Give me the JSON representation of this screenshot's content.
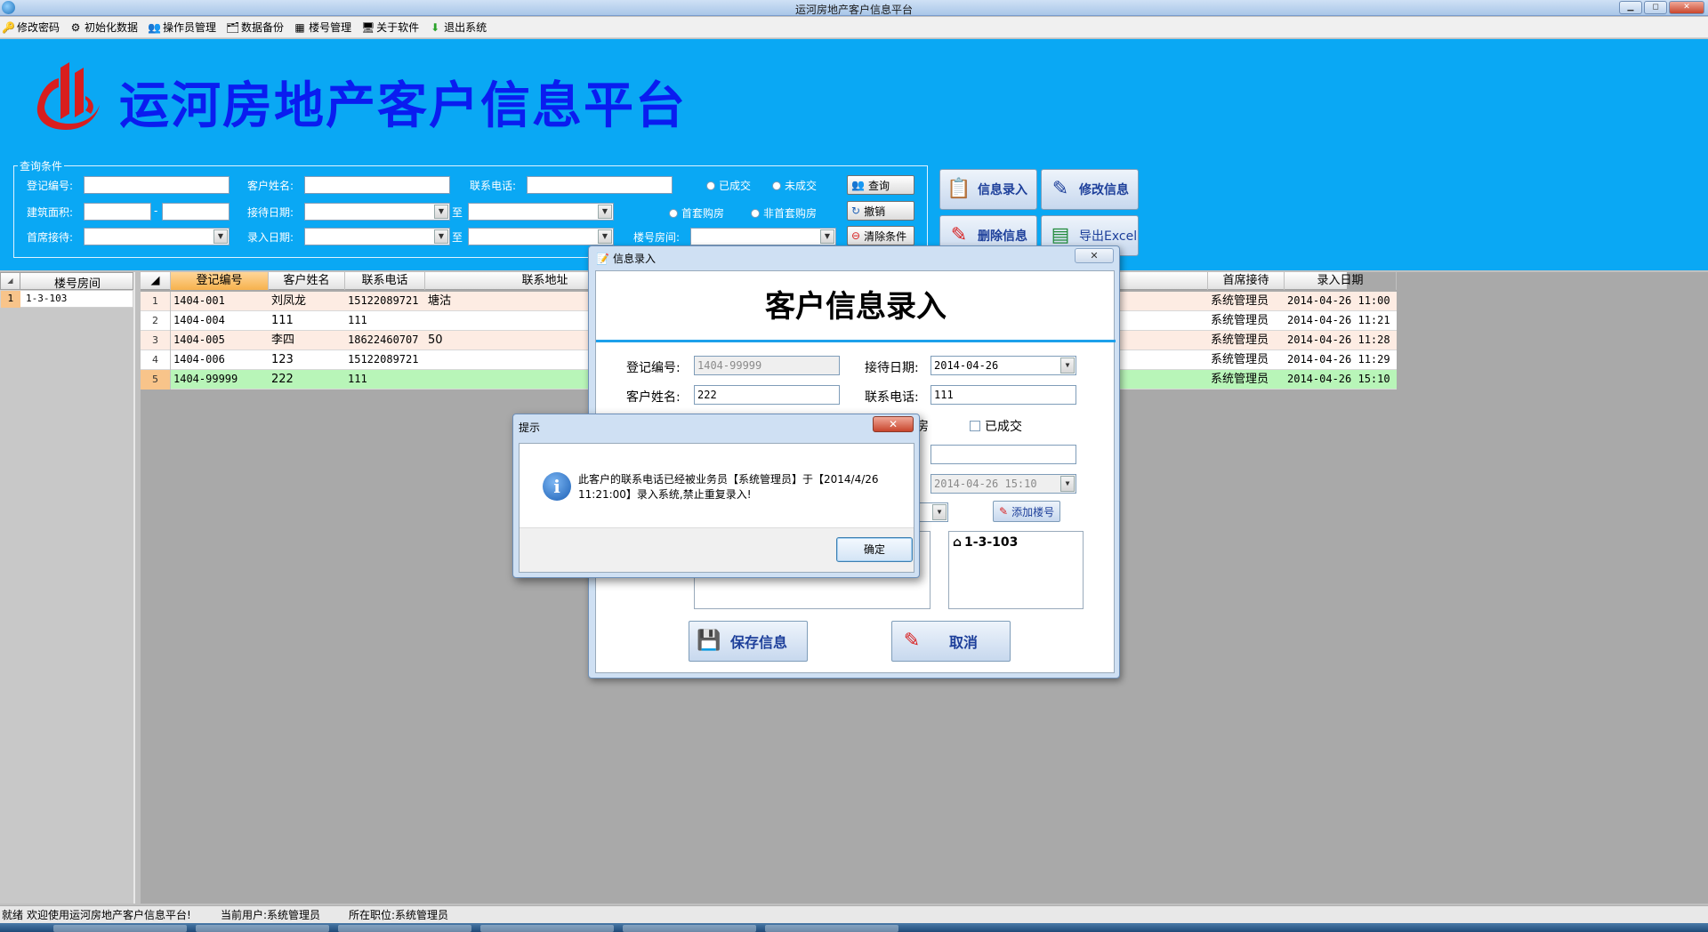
{
  "window": {
    "title": "运河房地产客户信息平台",
    "buttons": {
      "minimize": "▁",
      "maximize": "◻",
      "close": "✕"
    }
  },
  "menu": [
    {
      "label": "修改密码",
      "icon": "key-icon"
    },
    {
      "label": "初始化数据",
      "icon": "gear-icon"
    },
    {
      "label": "操作员管理",
      "icon": "users-icon"
    },
    {
      "label": "数据备份",
      "icon": "backup-icon"
    },
    {
      "label": "楼号管理",
      "icon": "building-icon"
    },
    {
      "label": "关于软件",
      "icon": "monitor-icon"
    },
    {
      "label": "退出系统",
      "icon": "exit-arrow-icon"
    }
  ],
  "banner": {
    "title": "运河房地产客户信息平台"
  },
  "query": {
    "legend": "查询条件",
    "labels": {
      "reg_no": "登记编号:",
      "customer_name": "客户姓名:",
      "phone": "联系电话:",
      "area": "建筑面积:",
      "area_sep": "-",
      "reception_date": "接待日期:",
      "to1": "至",
      "first_reception": "首席接待:",
      "entry_date": "录入日期:",
      "to2": "至",
      "room": "楼号房间:"
    },
    "radios": {
      "closed": "已成交",
      "not_closed": "未成交",
      "first_buy": "首套购房",
      "not_first_buy": "非首套购房"
    },
    "buttons": {
      "search": "查询",
      "cancel": "撤销",
      "clear": "清除条件"
    }
  },
  "actions": {
    "entry": "信息录入",
    "edit": "修改信息",
    "delete": "删除信息",
    "export": "导出Excel"
  },
  "left_grid": {
    "header": "楼号房间",
    "rows": [
      {
        "num": "1",
        "value": "1-3-103"
      }
    ]
  },
  "main_grid": {
    "columns": [
      "登记编号",
      "客户姓名",
      "联系电话",
      "联系地址",
      "首席接待",
      "录入日期"
    ],
    "rows": [
      {
        "num": "1",
        "reg_no": "1404-001",
        "name": "刘凤龙",
        "phone": "15122089721",
        "address": "塘沽",
        "reception": "系统管理员",
        "entry": "2014-04-26 11:00"
      },
      {
        "num": "2",
        "reg_no": "1404-004",
        "name": "111",
        "phone": "111",
        "address": "",
        "reception": "系统管理员",
        "entry": "2014-04-26 11:21"
      },
      {
        "num": "3",
        "reg_no": "1404-005",
        "name": "李四",
        "phone": "18622460707",
        "address": "50",
        "reception": "系统管理员",
        "entry": "2014-04-26 11:28"
      },
      {
        "num": "4",
        "reg_no": "1404-006",
        "name": "123",
        "phone": "15122089721",
        "address": "",
        "reception": "系统管理员",
        "entry": "2014-04-26 11:29"
      },
      {
        "num": "5",
        "reg_no": "1404-99999",
        "name": "222",
        "phone": "111",
        "address": "",
        "reception": "系统管理员",
        "entry": "2014-04-26 15:10"
      }
    ]
  },
  "status": {
    "ready": "就绪",
    "welcome": "欢迎使用运河房地产客户信息平台!",
    "current_user": "当前用户:系统管理员",
    "position": "所在职位:系统管理员"
  },
  "entry_dialog": {
    "title": "信息录入",
    "close": "✕",
    "heading": "客户信息录入",
    "labels": {
      "reg_no": "登记编号:",
      "reception_date": "接待日期:",
      "customer_name": "客户姓名:",
      "phone": "联系电话:",
      "first_buy_tail": "房",
      "closed": "已成交"
    },
    "values": {
      "reg_no": "1404-99999",
      "reception_date": "2014-04-26",
      "customer_name": "222",
      "phone": "111",
      "entry_datetime": "2014-04-26 15:10"
    },
    "buttons": {
      "add_room": "添加楼号",
      "save": "保存信息",
      "cancel": "取消"
    },
    "rooms": [
      "1-3-103"
    ]
  },
  "message_box": {
    "title": "提示",
    "close": "✕",
    "text": "此客户的联系电话已经被业务员【系统管理员】于【2014/4/26 11:21:00】录入系统,禁止重复录入!",
    "ok": "确定"
  },
  "colors": {
    "banner": "#0aa8f4",
    "banner_title": "#0a1cf0",
    "row_alt": "#fdece3",
    "row_selected": "#b8f5b8",
    "header_active": "#f6b24d"
  }
}
